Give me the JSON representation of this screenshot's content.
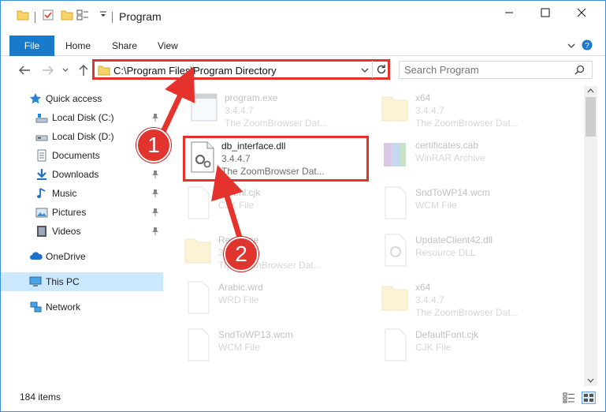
{
  "window": {
    "title": "Program",
    "controls": {
      "minimize": "minimize-icon",
      "maximize": "maximize-icon",
      "close": "close-icon"
    }
  },
  "ribbon": {
    "tabs": [
      {
        "label": "File",
        "active": true
      },
      {
        "label": "Home"
      },
      {
        "label": "Share"
      },
      {
        "label": "View"
      }
    ]
  },
  "address": {
    "path": "C:\\Program Files\\Program Directory"
  },
  "search": {
    "placeholder": "Search Program"
  },
  "nav": {
    "quick_access": "Quick access",
    "items": [
      {
        "label": "Local Disk (C:)",
        "icon": "drive-icon",
        "pinned": true
      },
      {
        "label": "Local Disk (D:)",
        "icon": "drive-icon",
        "pinned": false
      },
      {
        "label": "Documents",
        "icon": "documents-icon",
        "pinned": true
      },
      {
        "label": "Downloads",
        "icon": "downloads-icon",
        "pinned": true
      },
      {
        "label": "Music",
        "icon": "music-icon",
        "pinned": true
      },
      {
        "label": "Pictures",
        "icon": "pictures-icon",
        "pinned": true
      },
      {
        "label": "Videos",
        "icon": "videos-icon",
        "pinned": true
      }
    ],
    "onedrive": "OneDrive",
    "thispc": "This PC",
    "network": "Network"
  },
  "files": [
    {
      "name": "program.exe",
      "line2": "3.4.4.7",
      "line3": "The ZoomBrowser Dat...",
      "icon": "exe-icon"
    },
    {
      "name": "x64",
      "line2": "3.4.4.7",
      "line3": "The ZoomBrowser Dat...",
      "icon": "folder-icon"
    },
    {
      "name": "db_interface.dll",
      "line2": "3.4.4.7",
      "line3": "The ZoomBrowser Dat...",
      "icon": "dll-icon"
    },
    {
      "name": "certificates.cab",
      "line2": "WinRAR Archive",
      "line3": "",
      "icon": "archive-icon"
    },
    {
      "name": "ZbNml.cjk",
      "line2": "CJK File",
      "line3": "",
      "icon": "file-icon"
    },
    {
      "name": "SndToWP14.wcm",
      "line2": "WCM File",
      "line3": "",
      "icon": "file-icon"
    },
    {
      "name": "Resource",
      "line2": "3.4.4.7",
      "line3": "The ZoomBrowser Dat...",
      "icon": "folder-icon"
    },
    {
      "name": "UpdateClient42.dll",
      "line2": "Resource DLL",
      "line3": "",
      "icon": "dll-icon"
    },
    {
      "name": "Arabic.wrd",
      "line2": "WRD File",
      "line3": "",
      "icon": "file-icon"
    },
    {
      "name": "x64",
      "line2": "3.4.4.7",
      "line3": "The ZoomBrowser Dat...",
      "icon": "folder-icon"
    },
    {
      "name": "SndToWP13.wcm",
      "line2": "WCM File",
      "line3": "",
      "icon": "file-icon"
    },
    {
      "name": "DefaultFont.cjk",
      "line2": "CJK File",
      "line3": "",
      "icon": "file-icon"
    }
  ],
  "status": {
    "count": "184 items"
  },
  "callouts": [
    "1",
    "2"
  ],
  "colors": {
    "accent": "#1979ca",
    "highlight": "#e5322c",
    "selected_nav": "#cce8ff"
  }
}
